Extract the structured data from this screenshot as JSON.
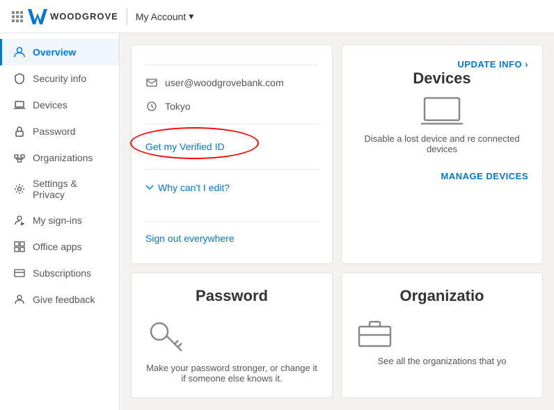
{
  "topnav": {
    "brand": "WOODGROVE",
    "account_label": "My Account",
    "chevron": "▾"
  },
  "sidebar": {
    "items": [
      {
        "id": "overview",
        "label": "Overview",
        "icon": "person-icon",
        "active": true
      },
      {
        "id": "security-info",
        "label": "Security info",
        "icon": "shield-icon",
        "active": false
      },
      {
        "id": "devices",
        "label": "Devices",
        "icon": "laptop-icon",
        "active": false
      },
      {
        "id": "password",
        "label": "Password",
        "icon": "lock-icon",
        "active": false
      },
      {
        "id": "organizations",
        "label": "Organizations",
        "icon": "org-icon",
        "active": false
      },
      {
        "id": "settings-privacy",
        "label": "Settings & Privacy",
        "icon": "gear-icon",
        "active": false
      },
      {
        "id": "my-sign-ins",
        "label": "My sign-ins",
        "icon": "signin-icon",
        "active": false
      },
      {
        "id": "office-apps",
        "label": "Office apps",
        "icon": "apps-icon",
        "active": false
      },
      {
        "id": "subscriptions",
        "label": "Subscriptions",
        "icon": "subscription-icon",
        "active": false
      },
      {
        "id": "give-feedback",
        "label": "Give feedback",
        "icon": "feedback-icon",
        "active": false
      }
    ]
  },
  "profile_card": {
    "email": "user@woodgrovebank.com",
    "location": "Tokyo",
    "verified_id_label": "Get my Verified ID",
    "why_label": "Why can't I edit?",
    "sign_out_label": "Sign out everywhere"
  },
  "devices_card": {
    "update_info_label": "UPDATE INFO ›",
    "title": "Devices",
    "description": "Disable a lost device and re connected devices",
    "manage_label": "MANAGE DEVICES"
  },
  "password_card": {
    "title": "Password",
    "description": "Make your password stronger, or change it if someone else knows it."
  },
  "organizations_card": {
    "title": "Organizatio",
    "description": "See all the organizations that yo"
  }
}
